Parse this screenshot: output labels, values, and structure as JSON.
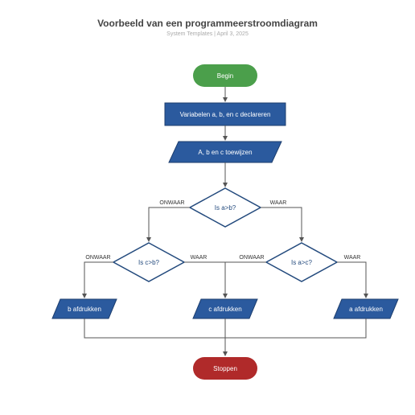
{
  "header": {
    "title": "Voorbeeld van een programmeerstroomdiagram",
    "subtitle": "System Templates  |  April 3, 2025"
  },
  "nodes": {
    "begin": "Begin",
    "declare": "Variabelen a, b, en c declareren",
    "assign": "A, b en c toewijzen",
    "d1": "Is a>b?",
    "d2": "Is c>b?",
    "d3": "Is a>c?",
    "outB": "b afdrukken",
    "outC": "c afdrukken",
    "outA": "a afdrukken",
    "stop": "Stoppen"
  },
  "labels": {
    "true": "WAAR",
    "false": "ONWAAR"
  },
  "colors": {
    "green": "#4b9f4b",
    "blue": "#2b5a9e",
    "red": "#b02a2a",
    "stroke": "#234a7d",
    "arrow": "#555"
  }
}
